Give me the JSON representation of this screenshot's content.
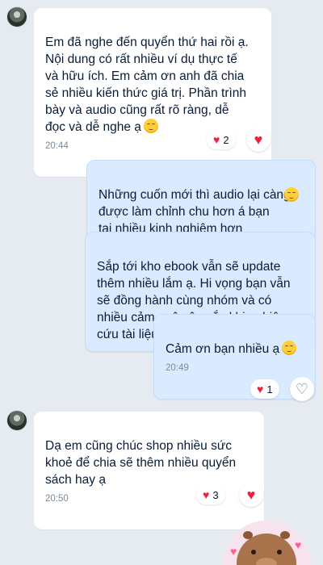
{
  "messages": [
    {
      "id": "m1",
      "direction": "incoming",
      "text": "Em đã nghe đến quyển thứ hai rồi ạ.\nNội dung có rất nhiều ví dụ thực tế\nvà hữu ích. Em cảm ơn anh đã chia\nsẻ nhiều kiến thức giá trị. Phần trình\nbày và audio cũng rất rõ ràng, dễ\nđọc và dễ nghe ạ",
      "emoji": "smiling-face-emoji",
      "time": "20:44",
      "reactions": {
        "icon": "heart-icon",
        "count": "2"
      }
    },
    {
      "id": "m2",
      "direction": "outgoing",
      "text": "Những cuốn mới thì audio lại càng\nđược làm chỉnh chu hơn á bạn\ntại nhiều kinh nghiệm hơn",
      "emoji": "smiling-face-emoji"
    },
    {
      "id": "m3",
      "direction": "outgoing",
      "text": "Sắp tới kho ebook vẫn sẽ update\nthêm nhiều lắm ạ. Hi vọng bạn vẫn\nsẽ đồng hành cùng nhóm và có\nnhiều cảm ngộ sâu sắc khi nghiên\ncứu tài liệu ạ"
    },
    {
      "id": "m4",
      "direction": "outgoing",
      "text": "Cảm ơn bạn nhiều ạ",
      "emoji": "smiling-face-emoji",
      "time": "20:49",
      "reactions": {
        "icon": "heart-icon",
        "count": "1"
      }
    },
    {
      "id": "m5",
      "direction": "incoming",
      "text": "Dạ em cũng chúc shop nhiều sức\nkhoẻ để chia sẽ thêm nhiều quyển\nsách hay ạ",
      "time": "20:50",
      "reactions": {
        "icon": "heart-icon",
        "count": "3"
      }
    }
  ],
  "sticker": {
    "icon": "capybara-sticker"
  },
  "colors": {
    "background": "#e6ebf2",
    "incoming_bubble": "#ffffff",
    "outgoing_bubble": "#dbebff",
    "heart": "#f0213a",
    "time_text": "#7d8a99"
  }
}
